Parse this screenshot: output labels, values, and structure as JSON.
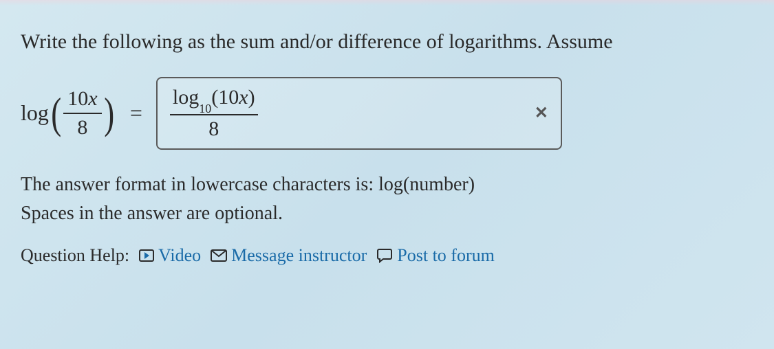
{
  "question": {
    "prompt": "Write the following as the sum and/or difference of logarithms. Assume",
    "expression": {
      "log_label": "log",
      "numerator_coeff": "10",
      "numerator_var": "x",
      "denominator": "8"
    },
    "equals": "=",
    "answer": {
      "log_label": "log",
      "log_base": "10",
      "arg_open": "(",
      "arg_coeff": "10",
      "arg_var": "x",
      "arg_close": ")",
      "denominator": "8",
      "status": "incorrect"
    },
    "hint_line1": "The answer format in lowercase characters is: log(number)",
    "hint_line2": "Spaces in the answer are optional."
  },
  "help": {
    "label": "Question Help:",
    "video": "Video",
    "message": "Message instructor",
    "forum": "Post to forum"
  },
  "icons": {
    "clear": "✕"
  }
}
